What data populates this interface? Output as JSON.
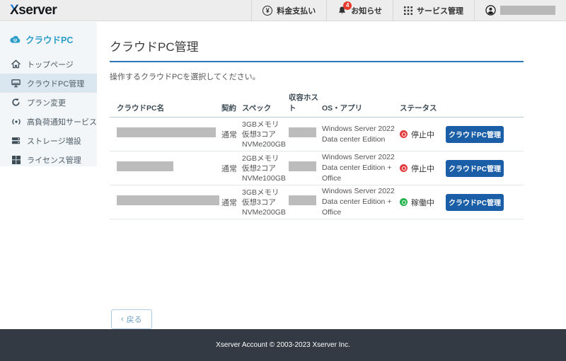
{
  "header": {
    "logo": "Xserver",
    "logo_x": "X",
    "logo_rest": "server",
    "nav": [
      {
        "label": "料金支払い",
        "icon": "yen-circle-icon",
        "icon_glyph": "¥"
      },
      {
        "label": "お知らせ",
        "icon": "bell-icon",
        "badge": "4"
      },
      {
        "label": "サービス管理",
        "icon": "grid-icon"
      },
      {
        "label": "",
        "icon": "account-icon",
        "redacted": true
      }
    ]
  },
  "sidebar": {
    "brand": {
      "label": "クラウドPC",
      "icon": "cloud-pc-icon",
      "color": "#2a9dc9"
    },
    "items": [
      {
        "label": "トップページ",
        "icon": "home-icon",
        "active": false
      },
      {
        "label": "クラウドPC管理",
        "icon": "desktop-pc-icon",
        "active": true
      },
      {
        "label": "プラン変更",
        "icon": "refresh-icon",
        "active": false
      },
      {
        "label": "高負荷通知サービス",
        "icon": "signal-icon",
        "active": false
      },
      {
        "label": "ストレージ増設",
        "icon": "storage-icon",
        "active": false
      },
      {
        "label": "ライセンス管理",
        "icon": "windows-icon",
        "active": false
      }
    ]
  },
  "main": {
    "title": "クラウドPC管理",
    "description": "操作するクラウドPCを選択してください。",
    "table": {
      "headers": [
        "クラウドPC名",
        "契約",
        "スペック",
        "収容ホスト",
        "OS・アプリ",
        "ステータス"
      ],
      "manage_button_label": "クラウドPC管理",
      "rows": [
        {
          "name_redacted": true,
          "contract": "通常",
          "spec": [
            "3GBメモリ",
            "仮想3コア",
            "NVMe200GB"
          ],
          "host_redacted": true,
          "os": "Windows Server 2022 Data center Edition",
          "status": "停止中",
          "status_color": "#e23b3c"
        },
        {
          "name_redacted": true,
          "contract": "通常",
          "spec": [
            "2GBメモリ",
            "仮想2コア",
            "NVMe100GB"
          ],
          "host_redacted": true,
          "os": "Windows Server 2022 Data center Edition + Office",
          "status": "停止中",
          "status_color": "#e23b3c"
        },
        {
          "name_redacted": true,
          "contract": "通常",
          "spec": [
            "3GBメモリ",
            "仮想3コア",
            "NVMe200GB"
          ],
          "host_redacted": true,
          "os": "Windows Server 2022 Data center Edition + Office",
          "status": "稼働中",
          "status_color": "#23b24b"
        }
      ]
    },
    "back_button": {
      "label": "戻る",
      "chevron": "‹"
    }
  },
  "footer": {
    "copyright": "Xserver Account © 2003-2023 Xserver Inc."
  },
  "colors": {
    "accent_blue": "#2d77b8",
    "button_blue": "#1a5ea7",
    "brand_cyan": "#2a9dc9",
    "status_stopped": "#e23b3c",
    "status_running": "#23b24b",
    "badge_red": "#e8392d"
  }
}
